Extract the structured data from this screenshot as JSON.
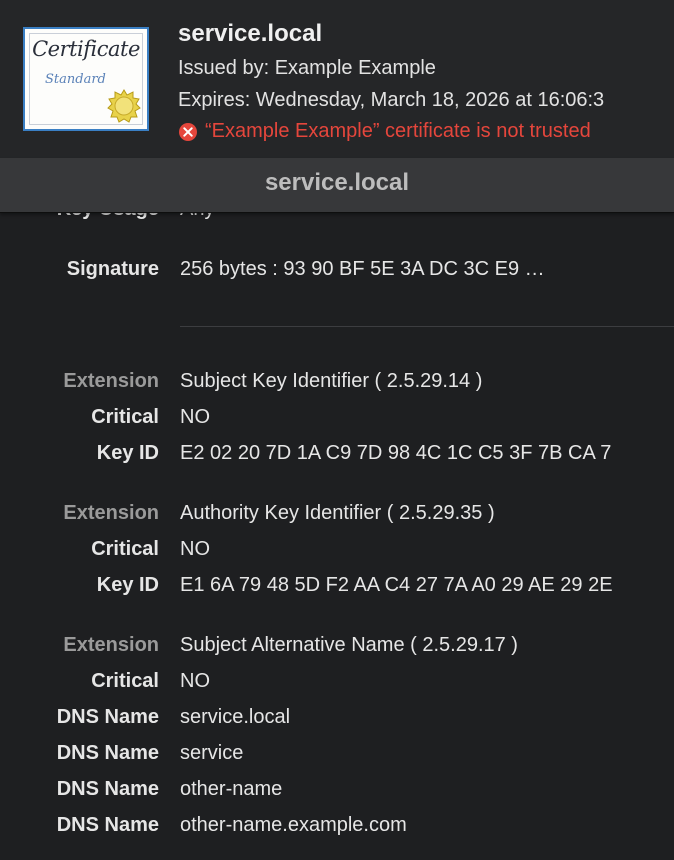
{
  "certificate": {
    "name": "service.local",
    "issued_by": "Issued by: Example Example",
    "expires": "Expires: Wednesday, March 18, 2026 at 16:06:3",
    "warning": "“Example Example” certificate is not trusted",
    "icon": {
      "title": "Certificate",
      "subtitle": "Standard"
    }
  },
  "section_title": "service.local",
  "fields": {
    "key_usage": {
      "label": "Key Usage",
      "value": "Any"
    },
    "signature": {
      "label": "Signature",
      "value": "256 bytes : 93 90 BF 5E 3A DC 3C E9 …"
    },
    "ext1": {
      "ext_label": "Extension",
      "ext_value": "Subject Key Identifier ( 2.5.29.14 )",
      "crit_label": "Critical",
      "crit_value": "NO",
      "key_label": "Key ID",
      "key_value": "E2 02 20 7D 1A C9 7D 98 4C 1C C5 3F 7B CA 7"
    },
    "ext2": {
      "ext_label": "Extension",
      "ext_value": "Authority Key Identifier ( 2.5.29.35 )",
      "crit_label": "Critical",
      "crit_value": "NO",
      "key_label": "Key ID",
      "key_value": "E1 6A 79 48 5D F2 AA C4 27 7A A0 29 AE 29 2E"
    },
    "ext3": {
      "ext_label": "Extension",
      "ext_value": "Subject Alternative Name ( 2.5.29.17 )",
      "crit_label": "Critical",
      "crit_value": "NO"
    },
    "dns": [
      {
        "label": "DNS Name",
        "value": "service.local"
      },
      {
        "label": "DNS Name",
        "value": "service"
      },
      {
        "label": "DNS Name",
        "value": "other-name"
      },
      {
        "label": "DNS Name",
        "value": "other-name.example.com"
      }
    ]
  },
  "icons": {
    "certificate": "certificate-icon",
    "warning": "error-circle-icon"
  },
  "colors": {
    "warning": "#e5463c",
    "background": "#1e1f21",
    "header_bar": "#37383a"
  }
}
